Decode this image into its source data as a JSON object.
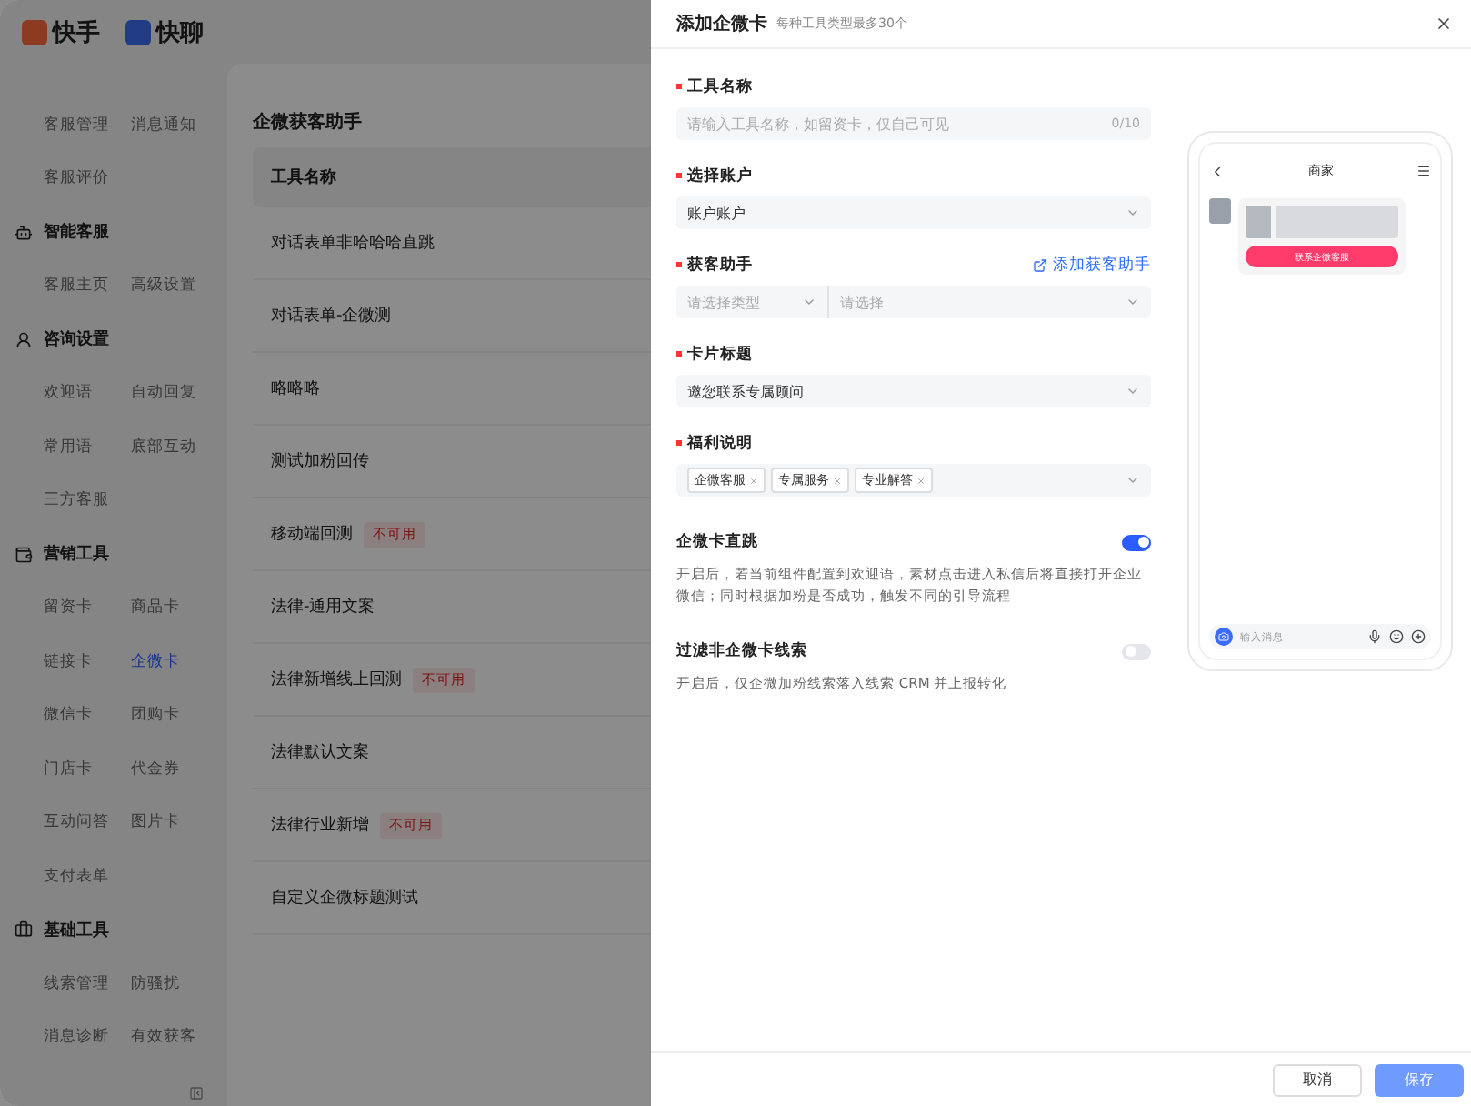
{
  "app": {
    "logos": [
      {
        "text": "快手"
      },
      {
        "text": "快聊"
      }
    ],
    "sidebar": {
      "groups": [
        {
          "items": [
            {
              "label": "客服管理",
              "selected": false
            },
            {
              "label": "消息通知",
              "selected": false
            },
            {
              "label": "客服评价",
              "selected": false
            }
          ]
        },
        {
          "title": "智能客服",
          "items": [
            {
              "label": "客服主页",
              "selected": false
            },
            {
              "label": "高级设置",
              "selected": false
            }
          ]
        },
        {
          "title": "咨询设置",
          "items": [
            {
              "label": "欢迎语",
              "selected": false
            },
            {
              "label": "自动回复",
              "selected": false
            },
            {
              "label": "常用语",
              "selected": false
            },
            {
              "label": "底部互动",
              "selected": false
            },
            {
              "label": "三方客服",
              "selected": false
            }
          ]
        },
        {
          "title": "营销工具",
          "items": [
            {
              "label": "留资卡",
              "selected": false
            },
            {
              "label": "商品卡",
              "selected": false
            },
            {
              "label": "链接卡",
              "selected": false
            },
            {
              "label": "企微卡",
              "selected": true
            },
            {
              "label": "微信卡",
              "selected": false
            },
            {
              "label": "团购卡",
              "selected": false
            },
            {
              "label": "门店卡",
              "selected": false
            },
            {
              "label": "代金券",
              "selected": false
            },
            {
              "label": "互动问答",
              "selected": false
            },
            {
              "label": "图片卡",
              "selected": false
            },
            {
              "label": "支付表单",
              "selected": false
            }
          ]
        },
        {
          "title": "基础工具",
          "items": [
            {
              "label": "线索管理",
              "selected": false
            },
            {
              "label": "防骚扰",
              "selected": false
            },
            {
              "label": "消息诊断",
              "selected": false
            },
            {
              "label": "有效获客",
              "selected": false
            }
          ]
        }
      ]
    },
    "page_title": "企微获客助手",
    "table": {
      "columns": [
        "工具名称"
      ],
      "rows": [
        {
          "name": "对话表单非哈哈哈直跳"
        },
        {
          "name": "对话表单-企微测"
        },
        {
          "name": "略略略"
        },
        {
          "name": "测试加粉回传"
        },
        {
          "name": "移动端回测",
          "badge": "不可用"
        },
        {
          "name": "法律-通用文案"
        },
        {
          "name": "法律新增线上回测",
          "badge": "不可用"
        },
        {
          "name": "法律默认文案"
        },
        {
          "name": "法律行业新增",
          "badge": "不可用"
        },
        {
          "name": "自定义企微标题测试"
        }
      ]
    }
  },
  "drawer": {
    "title": "添加企微卡",
    "subtitle": "每种工具类型最多30个",
    "fields": [
      {
        "kind": "input",
        "label": "工具名称",
        "required": true,
        "placeholder": "请输入工具名称，如留资卡，仅自己可见",
        "counter": "0/10"
      },
      {
        "kind": "select",
        "label": "选择账户",
        "required": true,
        "value": "账户账户"
      },
      {
        "kind": "dual_select",
        "label": "获客助手",
        "required": true,
        "link": "添加获客助手",
        "placeholders": [
          "请选择类型",
          "请选择"
        ]
      },
      {
        "kind": "select",
        "label": "卡片标题",
        "required": true,
        "value": "邀您联系专属顾问"
      },
      {
        "kind": "tags",
        "label": "福利说明",
        "required": true,
        "tags": [
          "企微客服",
          "专属服务",
          "专业解答"
        ]
      }
    ],
    "toggles": [
      {
        "label": "企微卡直跳",
        "on": true,
        "description": "开启后，若当前组件配置到欢迎语，素材点击进入私信后将直接打开企业微信；同时根据加粉是否成功，触发不同的引导流程"
      },
      {
        "label": "过滤非企微卡线索",
        "on": false,
        "description": "开启后，仅企微加粉线索落入线索 CRM 并上报转化"
      }
    ],
    "preview": {
      "title": "商家",
      "button": "联系企微客服",
      "input_placeholder": "输入消息"
    },
    "buttons": [
      {
        "label": "取消",
        "kind": "secondary"
      },
      {
        "label": "保存",
        "kind": "primary",
        "disabled": true
      }
    ]
  }
}
